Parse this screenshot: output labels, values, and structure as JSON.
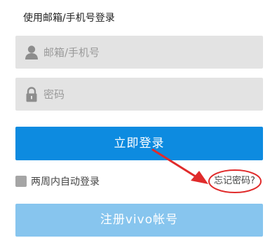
{
  "login": {
    "title": "使用邮箱/手机号登录",
    "username_placeholder": "邮箱/手机号",
    "password_placeholder": "密码",
    "login_button": "立即登录",
    "remember_label": "两周内自动登录",
    "forgot_link": "忘记密码?",
    "register_button": "注册vivo帐号"
  },
  "icons": {
    "user": "user-icon",
    "lock": "lock-icon"
  },
  "colors": {
    "primary": "#0d8be0",
    "register": "#87c5ee",
    "field_bg": "#e3e3e3",
    "annotation": "#e02b2b"
  }
}
